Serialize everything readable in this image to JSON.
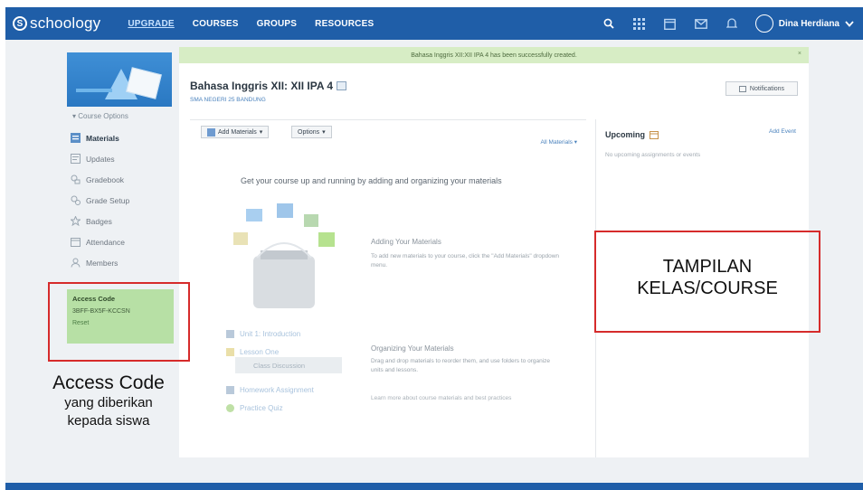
{
  "nav": {
    "logo": "schoology",
    "links": [
      "UPGRADE",
      "COURSES",
      "GROUPS",
      "RESOURCES"
    ],
    "user_name": "Dina Herdiana"
  },
  "banner": "Bahasa Inggris XII:XII IPA 4 has been successfully created.",
  "banner_close": "×",
  "sidebar": {
    "course_options": "Course Options",
    "items": [
      "Materials",
      "Updates",
      "Gradebook",
      "Grade Setup",
      "Badges",
      "Attendance",
      "Members"
    ],
    "access": {
      "title": "Access Code",
      "code": "3BFF-BX5F-KCCSN",
      "reset": "Reset"
    }
  },
  "course": {
    "title": "Bahasa Inggris XII: XII IPA 4",
    "school": "SMA NEGERI 25 BANDUNG",
    "notifications": "Notifications"
  },
  "toolbar": {
    "add_materials": "Add Materials",
    "options": "Options",
    "all_materials": "All Materials"
  },
  "empty_state": {
    "heading": "Get your course up and running by adding and organizing your materials",
    "add_title": "Adding Your Materials",
    "add_text": "To add new materials to your course, click the \"Add Materials\" dropdown menu.",
    "org_title": "Organizing Your Materials",
    "org_text": "Drag and drop materials to reorder them, and use folders to organize units and lessons.",
    "learn": "Learn more about course materials and best practices",
    "materials": [
      "Unit 1: Introduction",
      "Lesson One",
      "Class Discussion",
      "Homework Assignment",
      "Practice Quiz"
    ]
  },
  "upcoming": {
    "title": "Upcoming",
    "add_event": "Add Event",
    "empty": "No upcoming assignments or events"
  },
  "annotations": {
    "course_label_line1": "TAMPILAN",
    "course_label_line2": "KELAS/COURSE",
    "access_line1": "Access Code",
    "access_line2": "yang diberikan",
    "access_line3": "kepada siswa"
  },
  "colors": {
    "topbar": "#1f5ea8",
    "accent_link": "#4a82bd",
    "banner": "#d7edc5",
    "access_box": "#b7e0a5",
    "annotation_frame": "#d62b2b"
  }
}
